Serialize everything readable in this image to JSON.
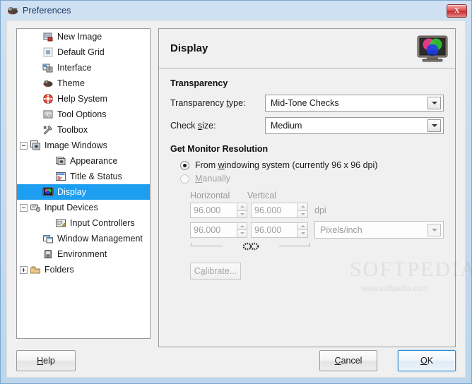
{
  "window": {
    "title": "Preferences",
    "title_icon": "gimp-wilber-icon",
    "close_label": "X",
    "accent_selection": "#1e9ef0",
    "watermark": "SOFTPEDIA",
    "watermark_sub": "www.softpedia.com"
  },
  "sidebar": {
    "items": [
      {
        "label": "New Image",
        "icon": "new-image-icon",
        "indent": 1,
        "expander": "none",
        "selected": false
      },
      {
        "label": "Default Grid",
        "icon": "default-grid-icon",
        "indent": 1,
        "expander": "none",
        "selected": false
      },
      {
        "label": "Interface",
        "icon": "interface-icon",
        "indent": 1,
        "expander": "none",
        "selected": false
      },
      {
        "label": "Theme",
        "icon": "theme-icon",
        "indent": 1,
        "expander": "none",
        "selected": false
      },
      {
        "label": "Help System",
        "icon": "help-system-icon",
        "indent": 1,
        "expander": "none",
        "selected": false
      },
      {
        "label": "Tool Options",
        "icon": "tool-options-icon",
        "indent": 1,
        "expander": "none",
        "selected": false
      },
      {
        "label": "Toolbox",
        "icon": "toolbox-icon",
        "indent": 1,
        "expander": "none",
        "selected": false
      },
      {
        "label": "Image Windows",
        "icon": "image-windows-icon",
        "indent": 0,
        "expander": "minus",
        "selected": false
      },
      {
        "label": "Appearance",
        "icon": "appearance-icon",
        "indent": 2,
        "expander": "none",
        "selected": false
      },
      {
        "label": "Title & Status",
        "icon": "title-status-icon",
        "indent": 2,
        "expander": "none",
        "selected": false
      },
      {
        "label": "Display",
        "icon": "display-icon",
        "indent": 1,
        "expander": "none",
        "selected": true
      },
      {
        "label": "Input Devices",
        "icon": "input-devices-icon",
        "indent": 0,
        "expander": "minus",
        "selected": false
      },
      {
        "label": "Input Controllers",
        "icon": "input-controllers-icon",
        "indent": 2,
        "expander": "none",
        "selected": false
      },
      {
        "label": "Window Management",
        "icon": "window-management-icon",
        "indent": 1,
        "expander": "none",
        "selected": false
      },
      {
        "label": "Environment",
        "icon": "environment-icon",
        "indent": 1,
        "expander": "none",
        "selected": false
      },
      {
        "label": "Folders",
        "icon": "folders-icon",
        "indent": 0,
        "expander": "plus",
        "selected": false
      }
    ]
  },
  "panel": {
    "title": "Display",
    "header_icon": "display-monitor-rgb-icon",
    "transparency": {
      "section_title": "Transparency",
      "type_label_pre": "Transparency ",
      "type_label_mnemonic": "t",
      "type_label_post": "ype:",
      "type_value": "Mid-Tone Checks",
      "size_label_pre": "Check ",
      "size_label_mnemonic": "s",
      "size_label_post": "ize:",
      "size_value": "Medium"
    },
    "resolution": {
      "section_title": "Get Monitor Resolution",
      "from_system_pre": "From ",
      "from_system_mnemonic": "w",
      "from_system_post": "indowing system (currently 96 x 96 dpi)",
      "from_system_selected": true,
      "manually_mnemonic": "M",
      "manually_post": "anually",
      "manually_selected": false,
      "horizontal_header": "Horizontal",
      "vertical_header": "Vertical",
      "horizontal_dpi": "96.000",
      "vertical_dpi": "96.000",
      "dpi_unit": "dpi",
      "horizontal_px": "96.000",
      "vertical_px": "96.000",
      "unit_value": "Pixels/inch",
      "chain_icon": "chain-broken-icon",
      "calibrate_pre": "C",
      "calibrate_mnemonic": "a",
      "calibrate_post": "librate...",
      "calibrate_enabled": false
    }
  },
  "buttons": {
    "help_mnemonic": "H",
    "help_pre": "",
    "help_post": "elp",
    "cancel_pre": "",
    "cancel_mnemonic": "C",
    "cancel_post": "ancel",
    "ok_mnemonic": "O",
    "ok_post": "K"
  }
}
